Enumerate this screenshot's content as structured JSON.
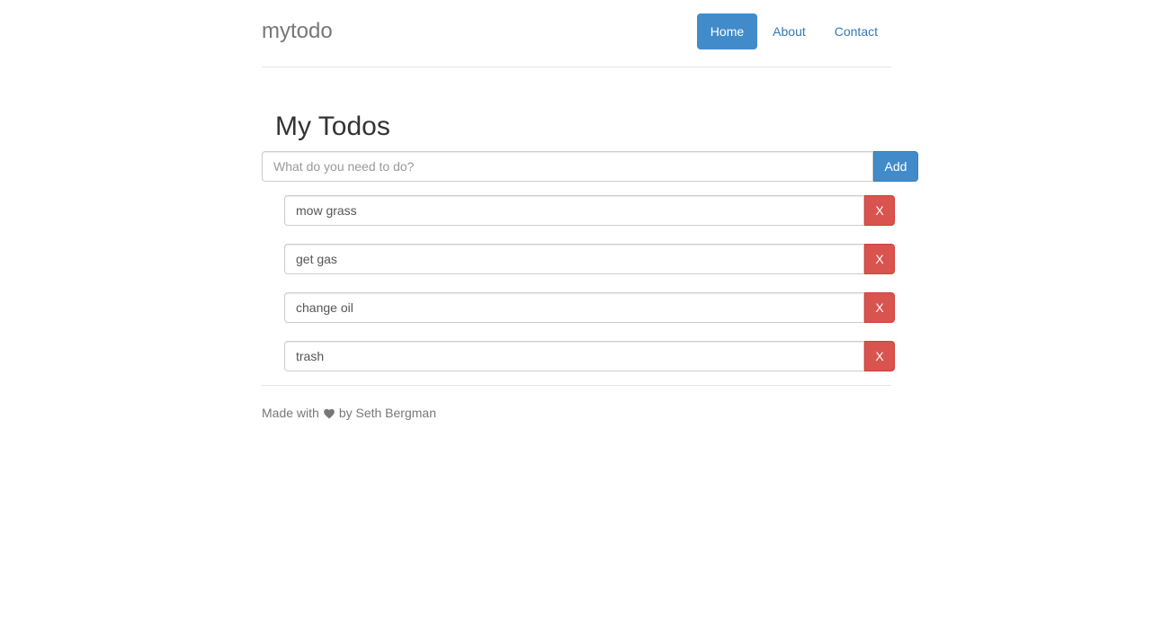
{
  "header": {
    "brand": "mytodo",
    "nav": [
      {
        "label": "Home",
        "active": true
      },
      {
        "label": "About",
        "active": false
      },
      {
        "label": "Contact",
        "active": false
      }
    ]
  },
  "main": {
    "title": "My Todos",
    "new_todo": {
      "placeholder": "What do you need to do?",
      "value": ""
    },
    "add_label": "Add",
    "todos": [
      {
        "text": "mow grass",
        "delete_label": "X"
      },
      {
        "text": "get gas",
        "delete_label": "X"
      },
      {
        "text": "change oil",
        "delete_label": "X"
      },
      {
        "text": "trash",
        "delete_label": "X"
      }
    ]
  },
  "footer": {
    "prefix": "Made with",
    "icon": "heart-icon",
    "suffix": "by Seth Bergman"
  },
  "colors": {
    "primary": "#428bca",
    "danger": "#d9534f",
    "link": "#337ab7",
    "muted": "#777777"
  }
}
